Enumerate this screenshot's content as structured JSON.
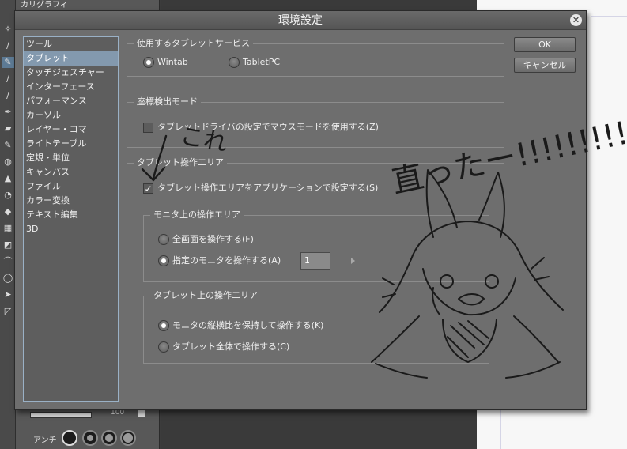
{
  "background_app": {
    "panel_title": "カリグラフィ",
    "tools": [
      "✧",
      "∕",
      "✎",
      "∕",
      "∕",
      "✒",
      "▰",
      "✎",
      "◍",
      "▲",
      "◔",
      "◆",
      "▦",
      "◩",
      "⌒",
      "◯",
      "➤",
      "◸"
    ],
    "brush_size_value": "100",
    "antialias_label": "アンチ"
  },
  "dialog": {
    "title": "環境設定",
    "categories": [
      "ツール",
      "タブレット",
      "タッチジェスチャー",
      "インターフェース",
      "パフォーマンス",
      "カーソル",
      "レイヤー・コマ",
      "ライトテーブル",
      "定規・単位",
      "キャンバス",
      "ファイル",
      "カラー変換",
      "テキスト編集",
      "3D"
    ],
    "selected_category": "タブレット",
    "buttons": {
      "ok": "OK",
      "cancel": "キャンセル"
    },
    "tablet_service": {
      "title": "使用するタブレットサービス",
      "wintab": "Wintab",
      "tabletpc": "TabletPC",
      "selected": "Wintab"
    },
    "coordinate_mode": {
      "title": "座標検出モード",
      "checkbox_label": "タブレットドライバの設定でマウスモードを使用する(Z)",
      "checked": false
    },
    "tablet_area": {
      "title": "タブレット操作エリア",
      "checkbox_label": "タブレット操作エリアをアプリケーションで設定する(S)",
      "checked": true,
      "monitor_area": {
        "title": "モニタ上の操作エリア",
        "full_screen": "全画面を操作する(F)",
        "specified_monitor": "指定のモニタを操作する(A)",
        "monitor_number": "1",
        "selected": "specified_monitor"
      },
      "tablet_sub_area": {
        "title": "タブレット上の操作エリア",
        "keep_aspect": "モニタの縦横比を保持して操作する(K)",
        "whole_tablet": "タブレット全体で操作する(C)",
        "selected": "keep_aspect"
      }
    }
  },
  "annotation": {
    "arrow_note": "これ",
    "fixed_note": "直ったー!!!!!!!!!"
  },
  "colors": {
    "dialog_bg": "#6e6e6e",
    "selection": "#8399ae",
    "ink": "#1a1a1a"
  }
}
